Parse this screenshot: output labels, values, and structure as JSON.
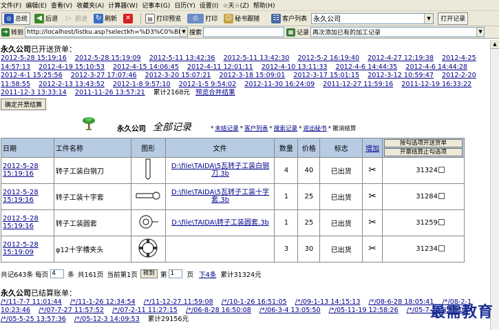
{
  "menu": [
    "文件(F)",
    "编辑(E)",
    "查看(V)",
    "收藏夹(A)",
    "计算器(W)",
    "记事本(G)",
    "日历(Y)",
    "设置(I)",
    "☆天☆(Z)",
    "帮助(H)"
  ],
  "toolbar": {
    "total_label": "总统",
    "back_label": "后退",
    "forward_label": "前进",
    "refresh_label": "刷新",
    "preview_label": "打印预览",
    "print_label": "打印",
    "secretary_label": "秘书跟随",
    "customers_label": "客户列表",
    "customer_value": "永久公司",
    "open_label": "打开记录"
  },
  "addressbar": {
    "goto_label": "转到",
    "url": "http://localhost/listku.asp?selectkh=%D3%C0%BE%C3%",
    "search_label": "搜索",
    "search_value": "",
    "record_label": "记录",
    "record_value": "再次添加已有的加工记录"
  },
  "top_section": {
    "company": "永久公司",
    "title_suffix": "已开送货单：",
    "links": [
      "2012-5-28 15:19:16",
      "2012-5-28 15:19:09",
      "2012-5-11 13:42:36",
      "2012-5-11 13:42:30",
      "2012-5-2 16:19:40",
      "2012-4-27 12:19:38",
      "2012-4-25 14:57:13",
      "2012-4-19 15:10:53",
      "2012-4-15 14:06:45",
      "2012-4-11 12:01:11",
      "2012-4-10 13:11:33",
      "2012-4-6 14:44:35",
      "2012-4-6 14:44:28",
      "2012-4-1 15:25:56",
      "2012-3-27 17:07:46",
      "2012-3-20 15:07:21",
      "2012-3-18 15:09:01",
      "2012-3-17 15:01:15",
      "2012-3-12 10:59:47",
      "2012-2-20 11:58:55",
      "2012-2-13 13:43:52",
      "2012-1-8 9:57:10",
      "2012-1-5 9:54:02",
      "2012-11-30 16:24:09",
      "2011-12-27 11:59:16",
      "2011-12-19 16:33:22",
      "2011-12-3 13:33:14",
      "2011-11-26 13:57:21"
    ],
    "total": "累计2168元",
    "merge_link": "预览合并结果",
    "confirm_button": "确定开票结算"
  },
  "heading": {
    "company": "永久公司",
    "all_records": "全部记录",
    "links": [
      "未结记录",
      "客户列表",
      "搜索记录",
      "退出秘书",
      "撤消结算"
    ]
  },
  "table": {
    "headers": [
      "日期",
      "工件名称",
      "图形",
      "文件",
      "数量",
      "价格",
      "标志",
      "增加"
    ],
    "header_buttons": [
      "按勾选项开送货单",
      "开票结算止勾选项"
    ],
    "rows": [
      {
        "date": "2012-5-28 15:19:16",
        "name": "转子工装白钢刀",
        "shape": "blade",
        "file": "D:\\file\\TAIDA\\5瓦转子工装白钢刀.3b",
        "qty": "4",
        "price": "40",
        "status": "已出货",
        "total": "31324"
      },
      {
        "date": "2012-5-28 15:19:16",
        "name": "转子工装十字套",
        "shape": "key",
        "file": "D:\\file\\TAIDA\\5瓦转子工装十字套.3b",
        "qty": "1",
        "price": "25",
        "status": "已出货",
        "total": "31284"
      },
      {
        "date": "2012-5-28 15:19:16",
        "name": "转子工装圆套",
        "shape": "ring",
        "file": "D:\\file\\TAIDA\\转子工装圆套.3b",
        "qty": "1",
        "price": "25",
        "status": "已出货",
        "total": "31259"
      },
      {
        "date": "2012-5-28 15:19:09",
        "name": "φ12十字槽夹头",
        "shape": "chuck",
        "file": "",
        "qty": "3",
        "price": "30",
        "status": "已出货",
        "total": "31234"
      }
    ]
  },
  "pager": {
    "total_count": "共记643条",
    "per_page_label": "每页",
    "per_page_value": "4",
    "rows_label": "条",
    "pages": "共161页",
    "current": "当前第1页",
    "goto_button": "转到",
    "page_prefix": "第",
    "page_value": "1",
    "page_suffix": "页",
    "next_link": "下4条",
    "sum": "累计31324元"
  },
  "bottom_section": {
    "company": "永久公司",
    "title_suffix": "已结算账单：",
    "links": [
      "/*/11-7-7 11:01:44",
      "/*/11-1-26 12:34:54",
      "/*/11-12-27 11:59:08",
      "/*/10-1-26 16:51:05",
      "/*/09-1-13 14:15:13",
      "/*/08-6-28 18:05:41",
      "/*/08-2-1 10:23:46",
      "/*/07-7-27 11:57:52",
      "/*/07-2-11 11:27:15",
      "/*/06-8-28 16:50:08",
      "/*/06-3-4 13:05:50",
      "/*/05-11-19 12:58:26",
      "/*/05-7-29 8:13:08",
      "/*/05-5-25 13:57:36",
      "/*/05-12-3 14:09:53"
    ],
    "total": "累计29156元"
  },
  "watermark": "最需教育"
}
